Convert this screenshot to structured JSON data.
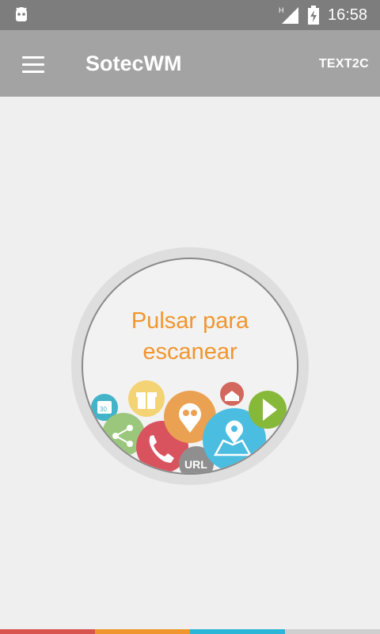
{
  "status_bar": {
    "time": "16:58",
    "network_type": "H",
    "icons": [
      "android-debug-icon",
      "signal-icon",
      "battery-charging-icon"
    ]
  },
  "app_bar": {
    "menu_icon": "hamburger-menu-icon",
    "title": "SotecWM",
    "action_label": "TEXT2C"
  },
  "scan_button": {
    "line1": "Pulsar para",
    "line2": "escanear",
    "bubble_icons": [
      "calendar-icon",
      "gift-icon",
      "location-pin-icon",
      "email-icon",
      "play-icon",
      "share-icon",
      "phone-icon",
      "url-icon",
      "map-icon"
    ],
    "url_text": "URL",
    "calendar_text": "30"
  },
  "colors": {
    "status_bar": "#7d7d7d",
    "app_bar": "#a3a3a3",
    "background": "#efefef",
    "accent_orange": "#f0962e",
    "stripe": [
      "#d9534f",
      "#f0962e",
      "#2bb5d6",
      "#cfcfcf"
    ]
  }
}
